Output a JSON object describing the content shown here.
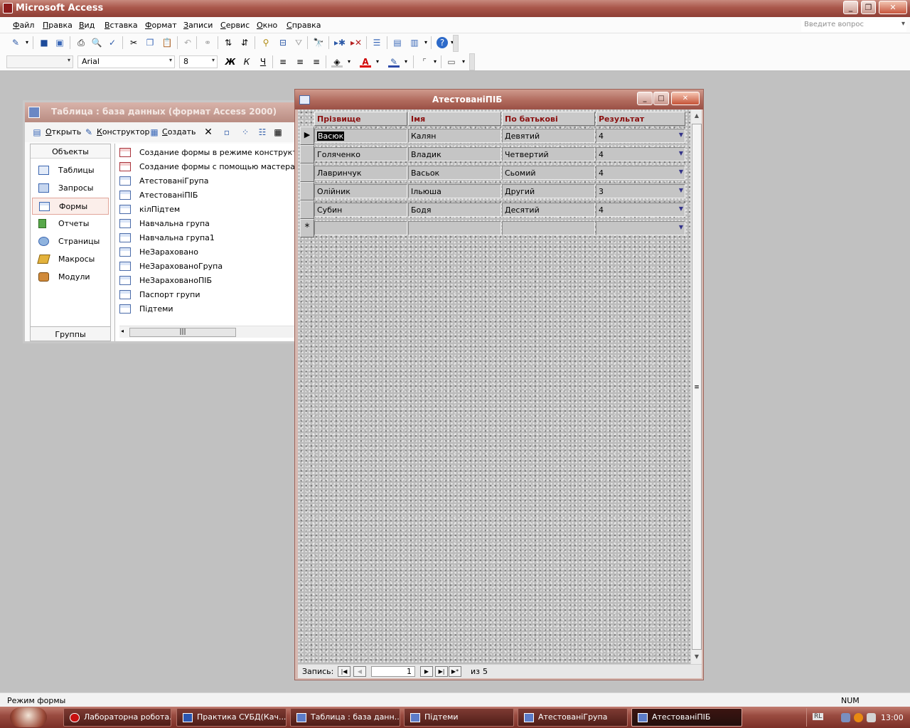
{
  "app": {
    "title": "Microsoft Access"
  },
  "menu": [
    "Файл",
    "Правка",
    "Вид",
    "Вставка",
    "Формат",
    "Записи",
    "Сервис",
    "Окно",
    "Справка"
  ],
  "question": {
    "placeholder": "Введите вопрос"
  },
  "format_toolbar": {
    "object_combo": "",
    "font": "Arial",
    "size": "8"
  },
  "db_window": {
    "title": "Таблица : база данных (формат Access 2000)",
    "toolbar": {
      "open": "Открыть",
      "design": "Конструктор",
      "create": "Создать"
    },
    "objects_header": "Объекты",
    "groups_label": "Группы",
    "objects": [
      "Таблицы",
      "Запросы",
      "Формы",
      "Отчеты",
      "Страницы",
      "Макросы",
      "Модули"
    ],
    "selected_object": "Формы",
    "items": [
      "Создание формы в режиме конструктора",
      "Создание формы с помощью мастера",
      "АтестованіГрупа",
      "АтестованіПІБ",
      "кілПідтем",
      "Навчальна група",
      "Навчальна група1",
      "НеЗараховано",
      "НеЗарахованоГрупа",
      "НеЗарахованоПІБ",
      "Паспорт групи",
      "Підтеми"
    ]
  },
  "form_window": {
    "title": "АтестованіПІБ",
    "columns": [
      "Прізвище",
      "Імя",
      "По батькові",
      "Результат"
    ],
    "rows": [
      [
        "Васюк",
        "Калян",
        "Девятий",
        "4"
      ],
      [
        "Голяченко",
        "Владик",
        "Четвертий",
        "4"
      ],
      [
        "Лавринчук",
        "Васьок",
        "Сьомий",
        "4"
      ],
      [
        "Олійник",
        "Ільюша",
        "Другий",
        "3"
      ],
      [
        "Субин",
        "Бодя",
        "Десятий",
        "4"
      ]
    ],
    "new_row_marker": "*",
    "nav": {
      "label": "Запись:",
      "current": "1",
      "of_label": "из",
      "total": "5"
    }
  },
  "status": {
    "text": "Режим формы",
    "num": "NUM"
  },
  "taskbar": {
    "tasks": [
      "Лабораторна робота...",
      "Практика СУБД(Кач...",
      "Таблица : база данн...",
      "Підтеми",
      "АтестованіГрупа",
      "АтестованіПІБ"
    ],
    "active": "АтестованіПІБ",
    "lang": "RL",
    "time": "13:00"
  },
  "colors": {
    "title_gradient": "#a9574b",
    "header_text": "#8b1010",
    "taskbar": "#9a4c41"
  }
}
